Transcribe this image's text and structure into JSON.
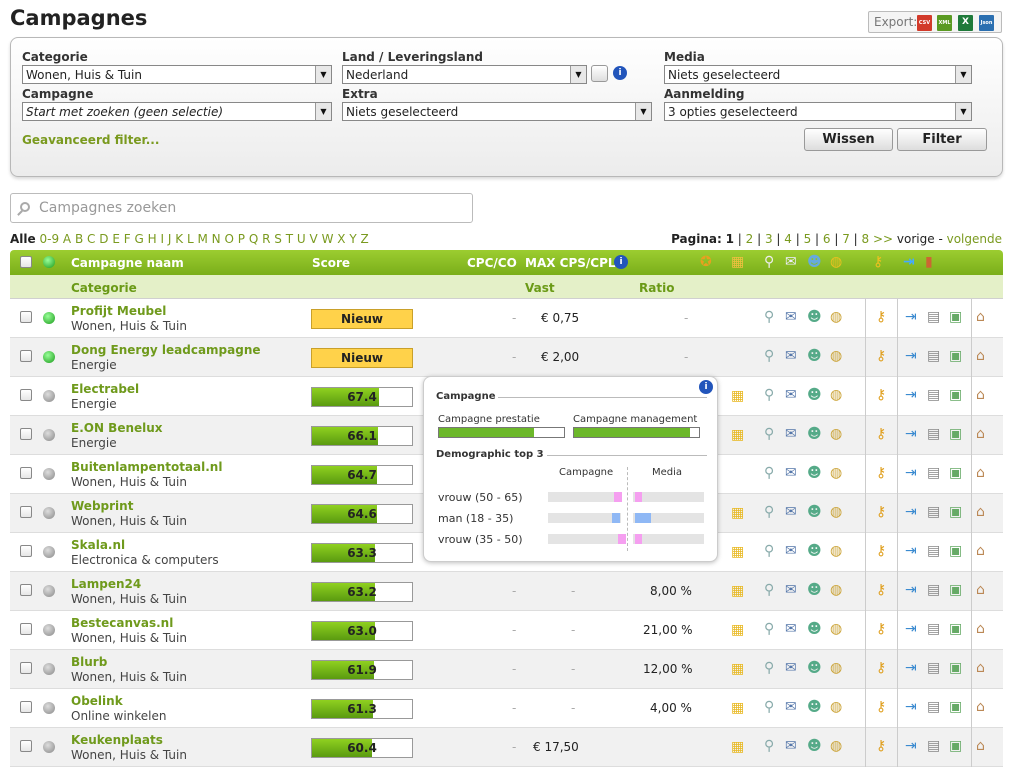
{
  "title": "Campagnes",
  "export": {
    "label": "Export:",
    "formats": [
      "CSV",
      "XML",
      "X",
      "Json"
    ]
  },
  "filter": {
    "categorie": {
      "label": "Categorie",
      "value": "Wonen, Huis & Tuin"
    },
    "land": {
      "label": "Land / Leveringsland",
      "value": "Nederland"
    },
    "media": {
      "label": "Media",
      "value": "Niets geselecteerd"
    },
    "campagne": {
      "label": "Campagne",
      "value": "Start met zoeken (geen selectie)"
    },
    "extra": {
      "label": "Extra",
      "value": "Niets geselecteerd"
    },
    "aanmelding": {
      "label": "Aanmelding",
      "value": "3 opties geselecteerd"
    },
    "advanced": "Geavanceerd filter...",
    "wissen": "Wissen",
    "filter_btn": "Filter"
  },
  "search": {
    "placeholder": "Campagnes zoeken"
  },
  "alpha": {
    "all": "Alle",
    "letters": [
      "0-9",
      "A",
      "B",
      "C",
      "D",
      "E",
      "F",
      "G",
      "H",
      "I",
      "J",
      "K",
      "L",
      "M",
      "N",
      "O",
      "P",
      "Q",
      "R",
      "S",
      "T",
      "U",
      "V",
      "W",
      "X",
      "Y",
      "Z"
    ]
  },
  "pager": {
    "label": "Pagina:",
    "current": "1",
    "pages": [
      "2",
      "3",
      "4",
      "5",
      "6",
      "7",
      "8"
    ],
    "more": ">>",
    "prev": "vorige",
    "next": "volgende"
  },
  "headers": {
    "name": "Campagne naam",
    "score": "Score",
    "cpc": "CPC/CO",
    "max": "MAX CPS/CPL",
    "category": "Categorie",
    "vast": "Vast",
    "ratio": "Ratio"
  },
  "rows": [
    {
      "name": "Profijt Meubel",
      "category": "Wonen, Huis & Tuin",
      "score": "Nieuw",
      "score_pct": 0,
      "cpc": "-",
      "vast": "€ 0,75",
      "ratio": "-",
      "active": true
    },
    {
      "name": "Dong Energy leadcampagne",
      "category": "Energie",
      "score": "Nieuw",
      "score_pct": 0,
      "cpc": "-",
      "vast": "€ 2,00",
      "ratio": "-",
      "active": true
    },
    {
      "name": "Electrabel",
      "category": "Energie",
      "score": "67.4",
      "score_pct": 67.4,
      "cpc": "",
      "vast": "",
      "ratio": "",
      "active": false
    },
    {
      "name": "E.ON Benelux",
      "category": "Energie",
      "score": "66.1",
      "score_pct": 66.1,
      "cpc": "",
      "vast": "",
      "ratio": "",
      "active": false
    },
    {
      "name": "Buitenlampentotaal.nl",
      "category": "Wonen, Huis & Tuin",
      "score": "64.7",
      "score_pct": 64.7,
      "cpc": "",
      "vast": "",
      "ratio": "",
      "active": false
    },
    {
      "name": "Webprint",
      "category": "Wonen, Huis & Tuin",
      "score": "64.6",
      "score_pct": 64.6,
      "cpc": "",
      "vast": "",
      "ratio": "",
      "active": false
    },
    {
      "name": "Skala.nl",
      "category": "Electronica & computers",
      "score": "63.3",
      "score_pct": 63.3,
      "cpc": "",
      "vast": "",
      "ratio": "",
      "active": false
    },
    {
      "name": "Lampen24",
      "category": "Wonen, Huis & Tuin",
      "score": "63.2",
      "score_pct": 63.2,
      "cpc": "-",
      "vast": "-",
      "ratio": "8,00 %",
      "active": false
    },
    {
      "name": "Bestecanvas.nl",
      "category": "Wonen, Huis & Tuin",
      "score": "63.0",
      "score_pct": 63.0,
      "cpc": "-",
      "vast": "-",
      "ratio": "21,00 %",
      "active": false
    },
    {
      "name": "Blurb",
      "category": "Wonen, Huis & Tuin",
      "score": "61.9",
      "score_pct": 61.9,
      "cpc": "-",
      "vast": "-",
      "ratio": "12,00 %",
      "active": false
    },
    {
      "name": "Obelink",
      "category": "Online winkelen",
      "score": "61.3",
      "score_pct": 61.3,
      "cpc": "-",
      "vast": "-",
      "ratio": "4,00 %",
      "active": false
    },
    {
      "name": "Keukenplaats",
      "category": "Wonen, Huis & Tuin",
      "score": "60.4",
      "score_pct": 60.4,
      "cpc": "-",
      "vast": "€ 17,50",
      "ratio": "",
      "active": false
    }
  ],
  "popup": {
    "campagne": "Campagne",
    "prestatie": {
      "label": "Campagne prestatie",
      "pct": 76
    },
    "management": {
      "label": "Campagne management",
      "pct": 93
    },
    "demo_title": "Demographic top 3",
    "col_campagne": "Campagne",
    "col_media": "Media",
    "demo": [
      {
        "label": "vrouw (50 - 65)",
        "color": "#f59ff0"
      },
      {
        "label": "man (18 - 35)",
        "color": "#8fb8f5"
      },
      {
        "label": "vrouw (35 - 50)",
        "color": "#f59ff0"
      }
    ]
  }
}
